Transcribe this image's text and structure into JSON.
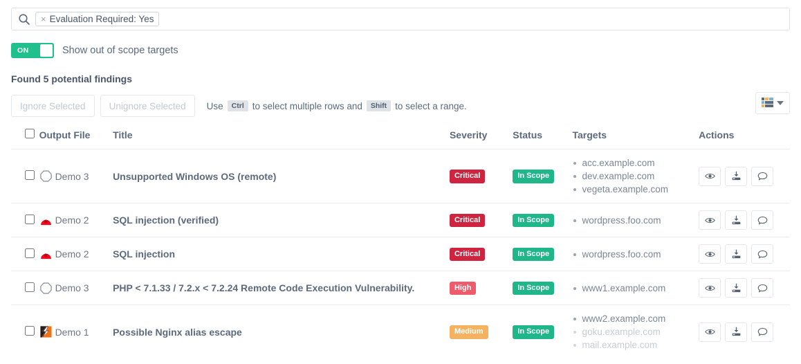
{
  "search": {
    "icon": "search-icon",
    "chip_remove": "×",
    "chip_label": "Evaluation Required: Yes",
    "placeholder": ""
  },
  "toggle": {
    "state_label": "ON",
    "description": "Show out of scope targets",
    "on_color": "#1fc08c"
  },
  "heading": "Found 5 potential findings",
  "toolbar": {
    "ignore_label": "Ignore Selected",
    "unignore_label": "Unignore Selected",
    "hint_prefix": "Use",
    "key_ctrl": "Ctrl",
    "hint_middle": "to select multiple rows and",
    "key_shift": "Shift",
    "hint_suffix": "to select a range.",
    "column_selector_icon": "columns-icon"
  },
  "table": {
    "columns": [
      "",
      "Output File",
      "Title",
      "Severity",
      "Status",
      "Targets",
      "Actions"
    ],
    "action_icons": [
      "eye-icon",
      "download-icon",
      "comment-icon"
    ],
    "rows": [
      {
        "output_file": "Demo 3",
        "output_icon": "octagon-outline-icon",
        "title": "Unsupported Windows OS (remote)",
        "severity": "Critical",
        "severity_class": "sev-critical",
        "status": "In Scope",
        "targets": [
          {
            "name": "acc.example.com",
            "out_of_scope": false
          },
          {
            "name": "dev.example.com",
            "out_of_scope": false
          },
          {
            "name": "vegeta.example.com",
            "out_of_scope": false
          }
        ]
      },
      {
        "output_file": "Demo 2",
        "output_icon": "red-dome-icon",
        "title": "SQL injection (verified)",
        "severity": "Critical",
        "severity_class": "sev-critical",
        "status": "In Scope",
        "targets": [
          {
            "name": "wordpress.foo.com",
            "out_of_scope": false
          }
        ]
      },
      {
        "output_file": "Demo 2",
        "output_icon": "red-dome-icon",
        "title": "SQL injection",
        "severity": "Critical",
        "severity_class": "sev-critical",
        "status": "In Scope",
        "targets": [
          {
            "name": "wordpress.foo.com",
            "out_of_scope": false
          }
        ]
      },
      {
        "output_file": "Demo 3",
        "output_icon": "octagon-outline-icon",
        "title": "PHP < 7.1.33 / 7.2.x < 7.2.24 Remote Code Execution Vulnerability.",
        "severity": "High",
        "severity_class": "sev-high",
        "status": "In Scope",
        "targets": [
          {
            "name": "www1.example.com",
            "out_of_scope": false
          }
        ]
      },
      {
        "output_file": "Demo 1",
        "output_icon": "lightning-bolt-icon",
        "title": "Possible Nginx alias escape",
        "severity": "Medium",
        "severity_class": "sev-medium",
        "status": "In Scope",
        "targets": [
          {
            "name": "www2.example.com",
            "out_of_scope": false
          },
          {
            "name": "goku.example.com",
            "out_of_scope": true
          },
          {
            "name": "mail.example.com",
            "out_of_scope": true
          }
        ]
      }
    ]
  },
  "colors": {
    "critical": "#cf2440",
    "high": "#ef5b6b",
    "medium": "#f5b362",
    "in_scope": "#1fb68a",
    "toggle_on": "#1fc08c"
  }
}
